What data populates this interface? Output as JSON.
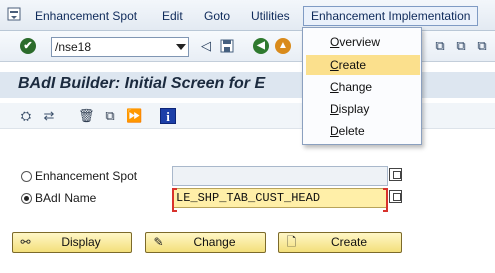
{
  "menubar": {
    "items": [
      {
        "label": "Enhancement Spot"
      },
      {
        "label": "Edit"
      },
      {
        "label": "Goto"
      },
      {
        "label": "Utilities"
      },
      {
        "label": "Enhancement Implementation"
      }
    ]
  },
  "toolbar": {
    "command_value": "/nse18"
  },
  "page": {
    "title": "BAdI Builder: Initial Screen for E"
  },
  "form": {
    "option1_label": "Enhancement Spot",
    "option1_value": "",
    "option2_label": "BAdI Name",
    "option2_value": "LE_SHP_TAB_CUST_HEAD",
    "selected_option": "BAdI Name"
  },
  "buttons": {
    "display": "Display",
    "change": "Change",
    "create": "Create"
  },
  "dropdown": {
    "items": [
      {
        "accel": "O",
        "rest": "verview"
      },
      {
        "accel": "C",
        "rest": "reate"
      },
      {
        "accel": "C",
        "rest": "hange"
      },
      {
        "accel": "D",
        "rest": "isplay"
      },
      {
        "accel": "D",
        "rest": "elete"
      }
    ],
    "highlighted": "Create"
  },
  "colors": {
    "menu_text": "#0e2a5a",
    "highlight": "#fbe08d",
    "button_fill": "#f3df7b",
    "required_marker": "#d8322c"
  }
}
